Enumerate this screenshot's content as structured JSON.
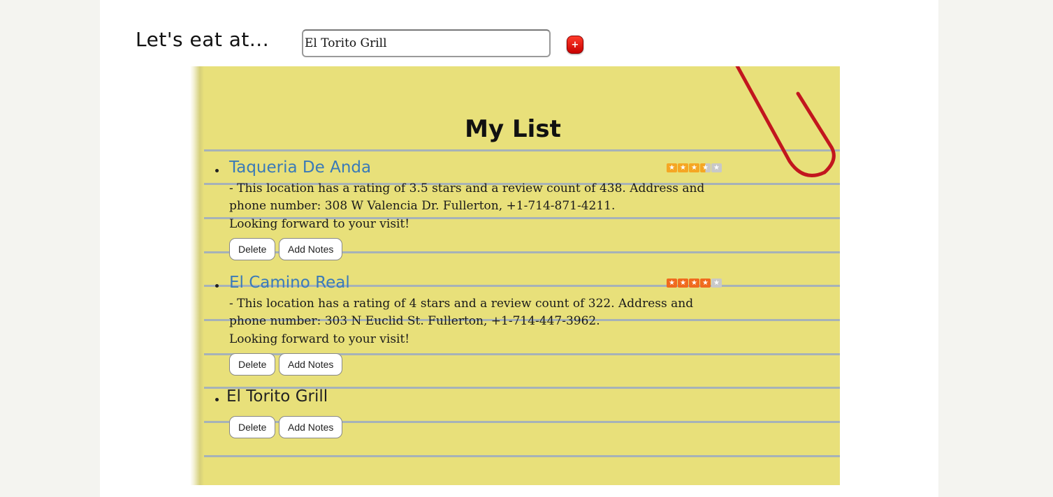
{
  "header": {
    "title": "Let's eat at...",
    "search_value": "El Torito Grill",
    "add_button_label": "+"
  },
  "list": {
    "title": "My List",
    "items": [
      {
        "name": "Taqueria De Anda",
        "rating": 3.5,
        "star_color": "#f5a623",
        "description": "- This location has a rating of 3.5 stars and a review count of 438. Address and phone number: 308 W Valencia Dr. Fullerton, +1-714-871-4211.",
        "closing": "Looking forward to your visit!",
        "delete_label": "Delete",
        "notes_label": "Add Notes"
      },
      {
        "name": "El Camino Real",
        "rating": 4,
        "star_color": "#f06a1e",
        "description": "- This location has a rating of 4 stars and a review count of 322. Address and phone number: 303 N Euclid St. Fullerton, +1-714-447-3962.",
        "closing": "Looking forward to your visit!",
        "delete_label": "Delete",
        "notes_label": "Add Notes"
      },
      {
        "name": "El Torito Grill",
        "delete_label": "Delete",
        "notes_label": "Add Notes"
      }
    ]
  },
  "colors": {
    "notepad": "#e8e07a",
    "rule_lines": "#a6b2b8",
    "link": "#3a7ab8",
    "paperclip": "#c2161e",
    "add_button": "#e01a0a",
    "star_empty": "#c8c8c8"
  }
}
